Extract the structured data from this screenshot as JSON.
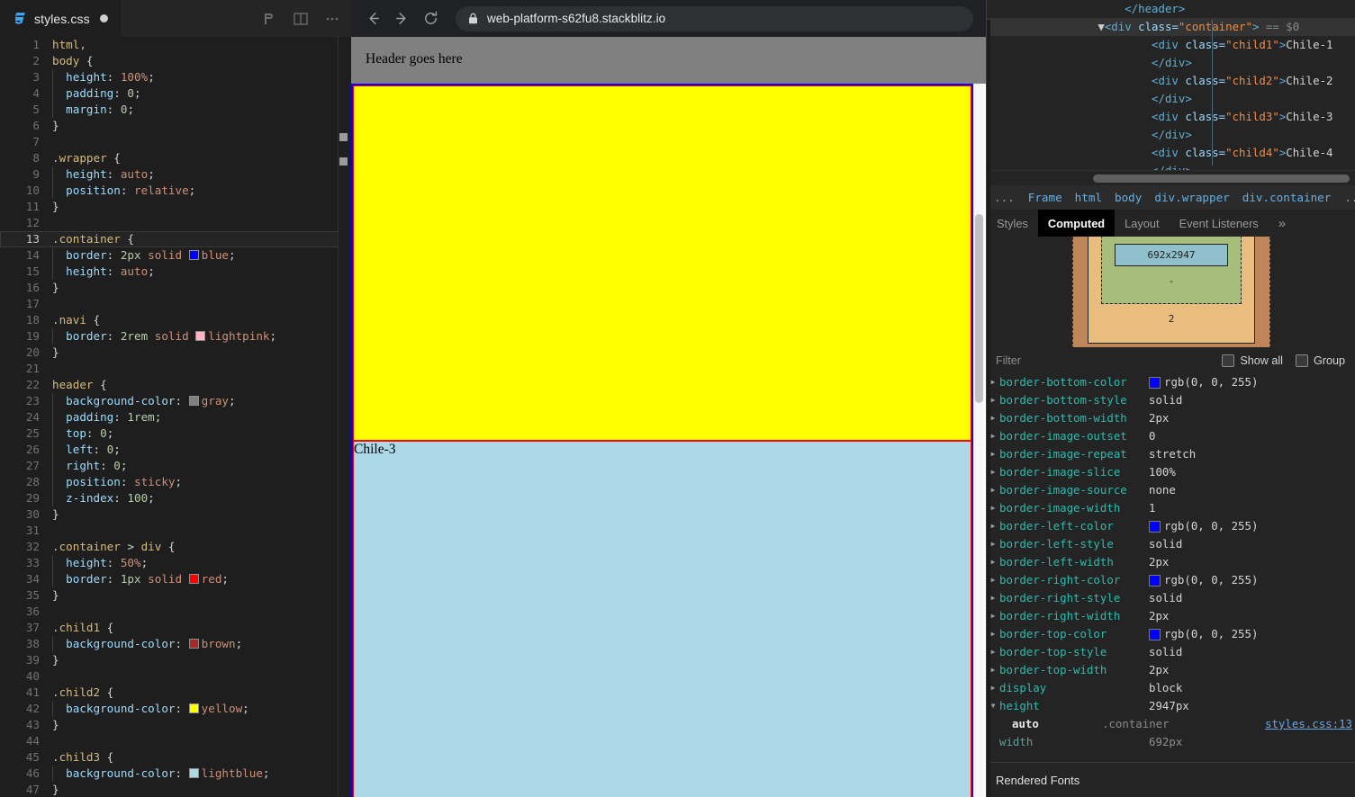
{
  "editor": {
    "tab": {
      "filename": "styles.css",
      "dirty_indicator": "●",
      "icon": "css-file-icon"
    },
    "actions": [
      {
        "name": "vite-logo-icon"
      },
      {
        "name": "split-editor-icon"
      },
      {
        "name": "more-actions-icon"
      }
    ],
    "highlighted_line": 13,
    "lines": [
      {
        "n": 1,
        "tokens": [
          {
            "t": "sel",
            "v": "html,"
          }
        ]
      },
      {
        "n": 2,
        "tokens": [
          {
            "t": "sel",
            "v": "body"
          },
          {
            "t": "punc",
            "v": " {"
          }
        ]
      },
      {
        "n": 3,
        "indent": 1,
        "tokens": [
          {
            "t": "prop",
            "v": "  height"
          },
          {
            "t": "punc",
            "v": ": "
          },
          {
            "t": "val",
            "v": "100%"
          },
          {
            "t": "punc",
            "v": ";"
          }
        ]
      },
      {
        "n": 4,
        "indent": 1,
        "tokens": [
          {
            "t": "prop",
            "v": "  padding"
          },
          {
            "t": "punc",
            "v": ": "
          },
          {
            "t": "num",
            "v": "0"
          },
          {
            "t": "punc",
            "v": ";"
          }
        ]
      },
      {
        "n": 5,
        "indent": 1,
        "tokens": [
          {
            "t": "prop",
            "v": "  margin"
          },
          {
            "t": "punc",
            "v": ": "
          },
          {
            "t": "num",
            "v": "0"
          },
          {
            "t": "punc",
            "v": ";"
          }
        ]
      },
      {
        "n": 6,
        "tokens": [
          {
            "t": "punc",
            "v": "}"
          }
        ]
      },
      {
        "n": 7,
        "tokens": []
      },
      {
        "n": 8,
        "tokens": [
          {
            "t": "sel",
            "v": ".wrapper"
          },
          {
            "t": "punc",
            "v": " {"
          }
        ]
      },
      {
        "n": 9,
        "indent": 1,
        "tokens": [
          {
            "t": "prop",
            "v": "  height"
          },
          {
            "t": "punc",
            "v": ": "
          },
          {
            "t": "val",
            "v": "auto"
          },
          {
            "t": "punc",
            "v": ";"
          }
        ]
      },
      {
        "n": 10,
        "indent": 1,
        "tokens": [
          {
            "t": "prop",
            "v": "  position"
          },
          {
            "t": "punc",
            "v": ": "
          },
          {
            "t": "val",
            "v": "relative"
          },
          {
            "t": "punc",
            "v": ";"
          }
        ]
      },
      {
        "n": 11,
        "tokens": [
          {
            "t": "punc",
            "v": "}"
          }
        ]
      },
      {
        "n": 12,
        "tokens": []
      },
      {
        "n": 13,
        "tokens": [
          {
            "t": "sel",
            "v": ".container"
          },
          {
            "t": "punc",
            "v": " {"
          }
        ]
      },
      {
        "n": 14,
        "indent": 1,
        "tokens": [
          {
            "t": "prop",
            "v": "  border"
          },
          {
            "t": "punc",
            "v": ": "
          },
          {
            "t": "num",
            "v": "2px"
          },
          {
            "t": "val",
            "v": " solid "
          },
          {
            "t": "swatch",
            "v": "blue",
            "color": "#0000ff"
          },
          {
            "t": "punc",
            "v": ";"
          }
        ]
      },
      {
        "n": 15,
        "indent": 1,
        "tokens": [
          {
            "t": "prop",
            "v": "  height"
          },
          {
            "t": "punc",
            "v": ": "
          },
          {
            "t": "val",
            "v": "auto"
          },
          {
            "t": "punc",
            "v": ";"
          }
        ]
      },
      {
        "n": 16,
        "tokens": [
          {
            "t": "punc",
            "v": "}"
          }
        ]
      },
      {
        "n": 17,
        "tokens": []
      },
      {
        "n": 18,
        "tokens": [
          {
            "t": "sel",
            "v": ".navi"
          },
          {
            "t": "punc",
            "v": " {"
          }
        ]
      },
      {
        "n": 19,
        "indent": 1,
        "tokens": [
          {
            "t": "prop",
            "v": "  border"
          },
          {
            "t": "punc",
            "v": ": "
          },
          {
            "t": "num",
            "v": "2rem"
          },
          {
            "t": "val",
            "v": " solid "
          },
          {
            "t": "swatch",
            "v": "lightpink",
            "color": "#ffb6c1"
          },
          {
            "t": "punc",
            "v": ";"
          }
        ]
      },
      {
        "n": 20,
        "tokens": [
          {
            "t": "punc",
            "v": "}"
          }
        ]
      },
      {
        "n": 21,
        "tokens": []
      },
      {
        "n": 22,
        "tokens": [
          {
            "t": "sel",
            "v": "header"
          },
          {
            "t": "punc",
            "v": " {"
          }
        ]
      },
      {
        "n": 23,
        "indent": 1,
        "tokens": [
          {
            "t": "prop",
            "v": "  background-color"
          },
          {
            "t": "punc",
            "v": ": "
          },
          {
            "t": "swatch",
            "v": "gray",
            "color": "#808080"
          },
          {
            "t": "punc",
            "v": ";"
          }
        ]
      },
      {
        "n": 24,
        "indent": 1,
        "tokens": [
          {
            "t": "prop",
            "v": "  padding"
          },
          {
            "t": "punc",
            "v": ": "
          },
          {
            "t": "num",
            "v": "1rem"
          },
          {
            "t": "punc",
            "v": ";"
          }
        ]
      },
      {
        "n": 25,
        "indent": 1,
        "tokens": [
          {
            "t": "prop",
            "v": "  top"
          },
          {
            "t": "punc",
            "v": ": "
          },
          {
            "t": "num",
            "v": "0"
          },
          {
            "t": "punc",
            "v": ";"
          }
        ]
      },
      {
        "n": 26,
        "indent": 1,
        "tokens": [
          {
            "t": "prop",
            "v": "  left"
          },
          {
            "t": "punc",
            "v": ": "
          },
          {
            "t": "num",
            "v": "0"
          },
          {
            "t": "punc",
            "v": ";"
          }
        ]
      },
      {
        "n": 27,
        "indent": 1,
        "tokens": [
          {
            "t": "prop",
            "v": "  right"
          },
          {
            "t": "punc",
            "v": ": "
          },
          {
            "t": "num",
            "v": "0"
          },
          {
            "t": "punc",
            "v": ";"
          }
        ]
      },
      {
        "n": 28,
        "indent": 1,
        "tokens": [
          {
            "t": "prop",
            "v": "  position"
          },
          {
            "t": "punc",
            "v": ": "
          },
          {
            "t": "val",
            "v": "sticky"
          },
          {
            "t": "punc",
            "v": ";"
          }
        ]
      },
      {
        "n": 29,
        "indent": 1,
        "tokens": [
          {
            "t": "prop",
            "v": "  z-index"
          },
          {
            "t": "punc",
            "v": ": "
          },
          {
            "t": "num",
            "v": "100"
          },
          {
            "t": "punc",
            "v": ";"
          }
        ]
      },
      {
        "n": 30,
        "tokens": [
          {
            "t": "punc",
            "v": "}"
          }
        ]
      },
      {
        "n": 31,
        "tokens": []
      },
      {
        "n": 32,
        "tokens": [
          {
            "t": "sel",
            "v": ".container"
          },
          {
            "t": "punc",
            "v": " > "
          },
          {
            "t": "sel",
            "v": "div"
          },
          {
            "t": "punc",
            "v": " {"
          }
        ]
      },
      {
        "n": 33,
        "indent": 1,
        "tokens": [
          {
            "t": "prop",
            "v": "  height"
          },
          {
            "t": "punc",
            "v": ": "
          },
          {
            "t": "val",
            "v": "50%"
          },
          {
            "t": "punc",
            "v": ";"
          }
        ]
      },
      {
        "n": 34,
        "indent": 1,
        "tokens": [
          {
            "t": "prop",
            "v": "  border"
          },
          {
            "t": "punc",
            "v": ": "
          },
          {
            "t": "num",
            "v": "1px"
          },
          {
            "t": "val",
            "v": " solid "
          },
          {
            "t": "swatch",
            "v": "red",
            "color": "#ff0000"
          },
          {
            "t": "punc",
            "v": ";"
          }
        ]
      },
      {
        "n": 35,
        "tokens": [
          {
            "t": "punc",
            "v": "}"
          }
        ]
      },
      {
        "n": 36,
        "tokens": []
      },
      {
        "n": 37,
        "tokens": [
          {
            "t": "sel",
            "v": ".child1"
          },
          {
            "t": "punc",
            "v": " {"
          }
        ]
      },
      {
        "n": 38,
        "indent": 1,
        "tokens": [
          {
            "t": "prop",
            "v": "  background-color"
          },
          {
            "t": "punc",
            "v": ": "
          },
          {
            "t": "swatch",
            "v": "brown",
            "color": "#a52a2a"
          },
          {
            "t": "punc",
            "v": ";"
          }
        ]
      },
      {
        "n": 39,
        "tokens": [
          {
            "t": "punc",
            "v": "}"
          }
        ]
      },
      {
        "n": 40,
        "tokens": []
      },
      {
        "n": 41,
        "tokens": [
          {
            "t": "sel",
            "v": ".child2"
          },
          {
            "t": "punc",
            "v": " {"
          }
        ]
      },
      {
        "n": 42,
        "indent": 1,
        "tokens": [
          {
            "t": "prop",
            "v": "  background-color"
          },
          {
            "t": "punc",
            "v": ": "
          },
          {
            "t": "swatch",
            "v": "yellow",
            "color": "#ffff00"
          },
          {
            "t": "punc",
            "v": ";"
          }
        ]
      },
      {
        "n": 43,
        "tokens": [
          {
            "t": "punc",
            "v": "}"
          }
        ]
      },
      {
        "n": 44,
        "tokens": []
      },
      {
        "n": 45,
        "tokens": [
          {
            "t": "sel",
            "v": ".child3"
          },
          {
            "t": "punc",
            "v": " {"
          }
        ]
      },
      {
        "n": 46,
        "indent": 1,
        "tokens": [
          {
            "t": "prop",
            "v": "  background-color"
          },
          {
            "t": "punc",
            "v": ": "
          },
          {
            "t": "swatch",
            "v": "lightblue",
            "color": "#add8e6"
          },
          {
            "t": "punc",
            "v": ";"
          }
        ]
      },
      {
        "n": 47,
        "tokens": [
          {
            "t": "punc",
            "v": "}"
          }
        ]
      }
    ]
  },
  "browser": {
    "nav": {
      "back_icon": "arrow-left-icon",
      "forward_icon": "arrow-right-icon",
      "reload_icon": "reload-icon"
    },
    "omnibox": {
      "lock_icon": "lock-icon",
      "url": "web-platform-s62fu8.stackblitz.io"
    },
    "page": {
      "header_text": "Header goes here",
      "header_bg": "#808080",
      "container_border": "#0000ff",
      "child_border": "#ff0000",
      "children": [
        {
          "class": "child2",
          "text": "",
          "bg": "#ffff00"
        },
        {
          "class": "child3",
          "text": "Chile-3",
          "bg": "#add8e6"
        }
      ]
    }
  },
  "devtools": {
    "dom": {
      "lines": [
        {
          "indent": 5,
          "parts": [
            {
              "t": "tag",
              "v": "&lt;/header&gt;"
            }
          ]
        },
        {
          "indent": 4,
          "selected": true,
          "parts": [
            {
              "t": "arrow",
              "v": "▼"
            },
            {
              "t": "tag",
              "v": "&lt;div "
            },
            {
              "t": "attr",
              "v": "class="
            },
            {
              "t": "val",
              "v": "\"container\""
            },
            {
              "t": "tag",
              "v": "&gt;"
            },
            {
              "t": "dollar",
              "v": " == $0"
            }
          ]
        },
        {
          "indent": 6,
          "parts": [
            {
              "t": "tag",
              "v": "&lt;div "
            },
            {
              "t": "attr",
              "v": "class="
            },
            {
              "t": "val",
              "v": "\"child1\""
            },
            {
              "t": "tag",
              "v": "&gt;"
            },
            {
              "t": "text",
              "v": "Chile-1"
            }
          ]
        },
        {
          "indent": 6,
          "parts": [
            {
              "t": "tag",
              "v": "&lt;/div&gt;"
            }
          ]
        },
        {
          "indent": 6,
          "parts": [
            {
              "t": "tag",
              "v": "&lt;div "
            },
            {
              "t": "attr",
              "v": "class="
            },
            {
              "t": "val",
              "v": "\"child2\""
            },
            {
              "t": "tag",
              "v": "&gt;"
            },
            {
              "t": "text",
              "v": "Chile-2"
            }
          ]
        },
        {
          "indent": 6,
          "parts": [
            {
              "t": "tag",
              "v": "&lt;/div&gt;"
            }
          ]
        },
        {
          "indent": 6,
          "parts": [
            {
              "t": "tag",
              "v": "&lt;div "
            },
            {
              "t": "attr",
              "v": "class="
            },
            {
              "t": "val",
              "v": "\"child3\""
            },
            {
              "t": "tag",
              "v": "&gt;"
            },
            {
              "t": "text",
              "v": "Chile-3"
            }
          ]
        },
        {
          "indent": 6,
          "parts": [
            {
              "t": "tag",
              "v": "&lt;/div&gt;"
            }
          ]
        },
        {
          "indent": 6,
          "parts": [
            {
              "t": "tag",
              "v": "&lt;div "
            },
            {
              "t": "attr",
              "v": "class="
            },
            {
              "t": "val",
              "v": "\"child4\""
            },
            {
              "t": "tag",
              "v": "&gt;"
            },
            {
              "t": "text",
              "v": "Chile-4"
            }
          ]
        },
        {
          "indent": 6,
          "parts": [
            {
              "t": "tag",
              "v": "&lt;/div&gt;"
            }
          ]
        }
      ]
    },
    "breadcrumb": [
      {
        "label": "...",
        "kind": "dots"
      },
      {
        "label": "Frame",
        "kind": "crumb"
      },
      {
        "label": "html",
        "kind": "crumb"
      },
      {
        "label": "body",
        "kind": "crumb"
      },
      {
        "label": "div.wrapper",
        "kind": "crumb"
      },
      {
        "label": "div.container",
        "kind": "crumb"
      },
      {
        "label": "...",
        "kind": "dots"
      }
    ],
    "tabs": [
      {
        "label": "Styles",
        "active": false
      },
      {
        "label": "Computed",
        "active": true
      },
      {
        "label": "Layout",
        "active": false
      },
      {
        "label": "Event Listeners",
        "active": false
      },
      {
        "label": "»",
        "active": false
      }
    ],
    "boxmodel": {
      "content_label": "692x2947",
      "padding_label": "-",
      "border_label": "2",
      "margin_label": "-"
    },
    "filter": {
      "placeholder": "Filter",
      "show_all_label": "Show all",
      "group_label": "Group"
    },
    "computed": [
      {
        "name": "border-bottom-color",
        "value": "rgb(0, 0, 255)",
        "swatch": "#0000ff"
      },
      {
        "name": "border-bottom-style",
        "value": "solid"
      },
      {
        "name": "border-bottom-width",
        "value": "2px"
      },
      {
        "name": "border-image-outset",
        "value": "0"
      },
      {
        "name": "border-image-repeat",
        "value": "stretch"
      },
      {
        "name": "border-image-slice",
        "value": "100%"
      },
      {
        "name": "border-image-source",
        "value": "none"
      },
      {
        "name": "border-image-width",
        "value": "1"
      },
      {
        "name": "border-left-color",
        "value": "rgb(0, 0, 255)",
        "swatch": "#0000ff"
      },
      {
        "name": "border-left-style",
        "value": "solid"
      },
      {
        "name": "border-left-width",
        "value": "2px"
      },
      {
        "name": "border-right-color",
        "value": "rgb(0, 0, 255)",
        "swatch": "#0000ff"
      },
      {
        "name": "border-right-style",
        "value": "solid"
      },
      {
        "name": "border-right-width",
        "value": "2px"
      },
      {
        "name": "border-top-color",
        "value": "rgb(0, 0, 255)",
        "swatch": "#0000ff"
      },
      {
        "name": "border-top-style",
        "value": "solid"
      },
      {
        "name": "border-top-width",
        "value": "2px"
      },
      {
        "name": "display",
        "value": "block"
      },
      {
        "name": "height",
        "value": "2947px",
        "expanded": true,
        "sub": {
          "value": "auto",
          "selector": ".container",
          "source": "styles.css:13"
        }
      },
      {
        "name": "width",
        "value": "692px",
        "dim": true,
        "no_tri": true
      }
    ],
    "rendered_fonts_label": "Rendered Fonts"
  }
}
